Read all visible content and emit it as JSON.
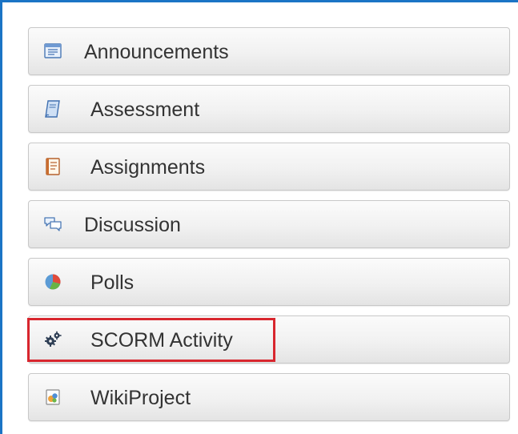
{
  "tools": {
    "items": [
      {
        "label": "Announcements",
        "icon": "announcements-icon"
      },
      {
        "label": "Assessment",
        "icon": "assessment-icon"
      },
      {
        "label": "Assignments",
        "icon": "assignments-icon"
      },
      {
        "label": "Discussion",
        "icon": "discussion-icon"
      },
      {
        "label": "Polls",
        "icon": "polls-icon"
      },
      {
        "label": "SCORM Activity",
        "icon": "scorm-gears-icon"
      },
      {
        "label": "WikiProject",
        "icon": "wikiproject-icon"
      }
    ],
    "highlighted": "SCORM Activity"
  },
  "colors": {
    "frame_border": "#1b74c5",
    "highlight_border": "#d8262e",
    "label_text": "#333333"
  }
}
